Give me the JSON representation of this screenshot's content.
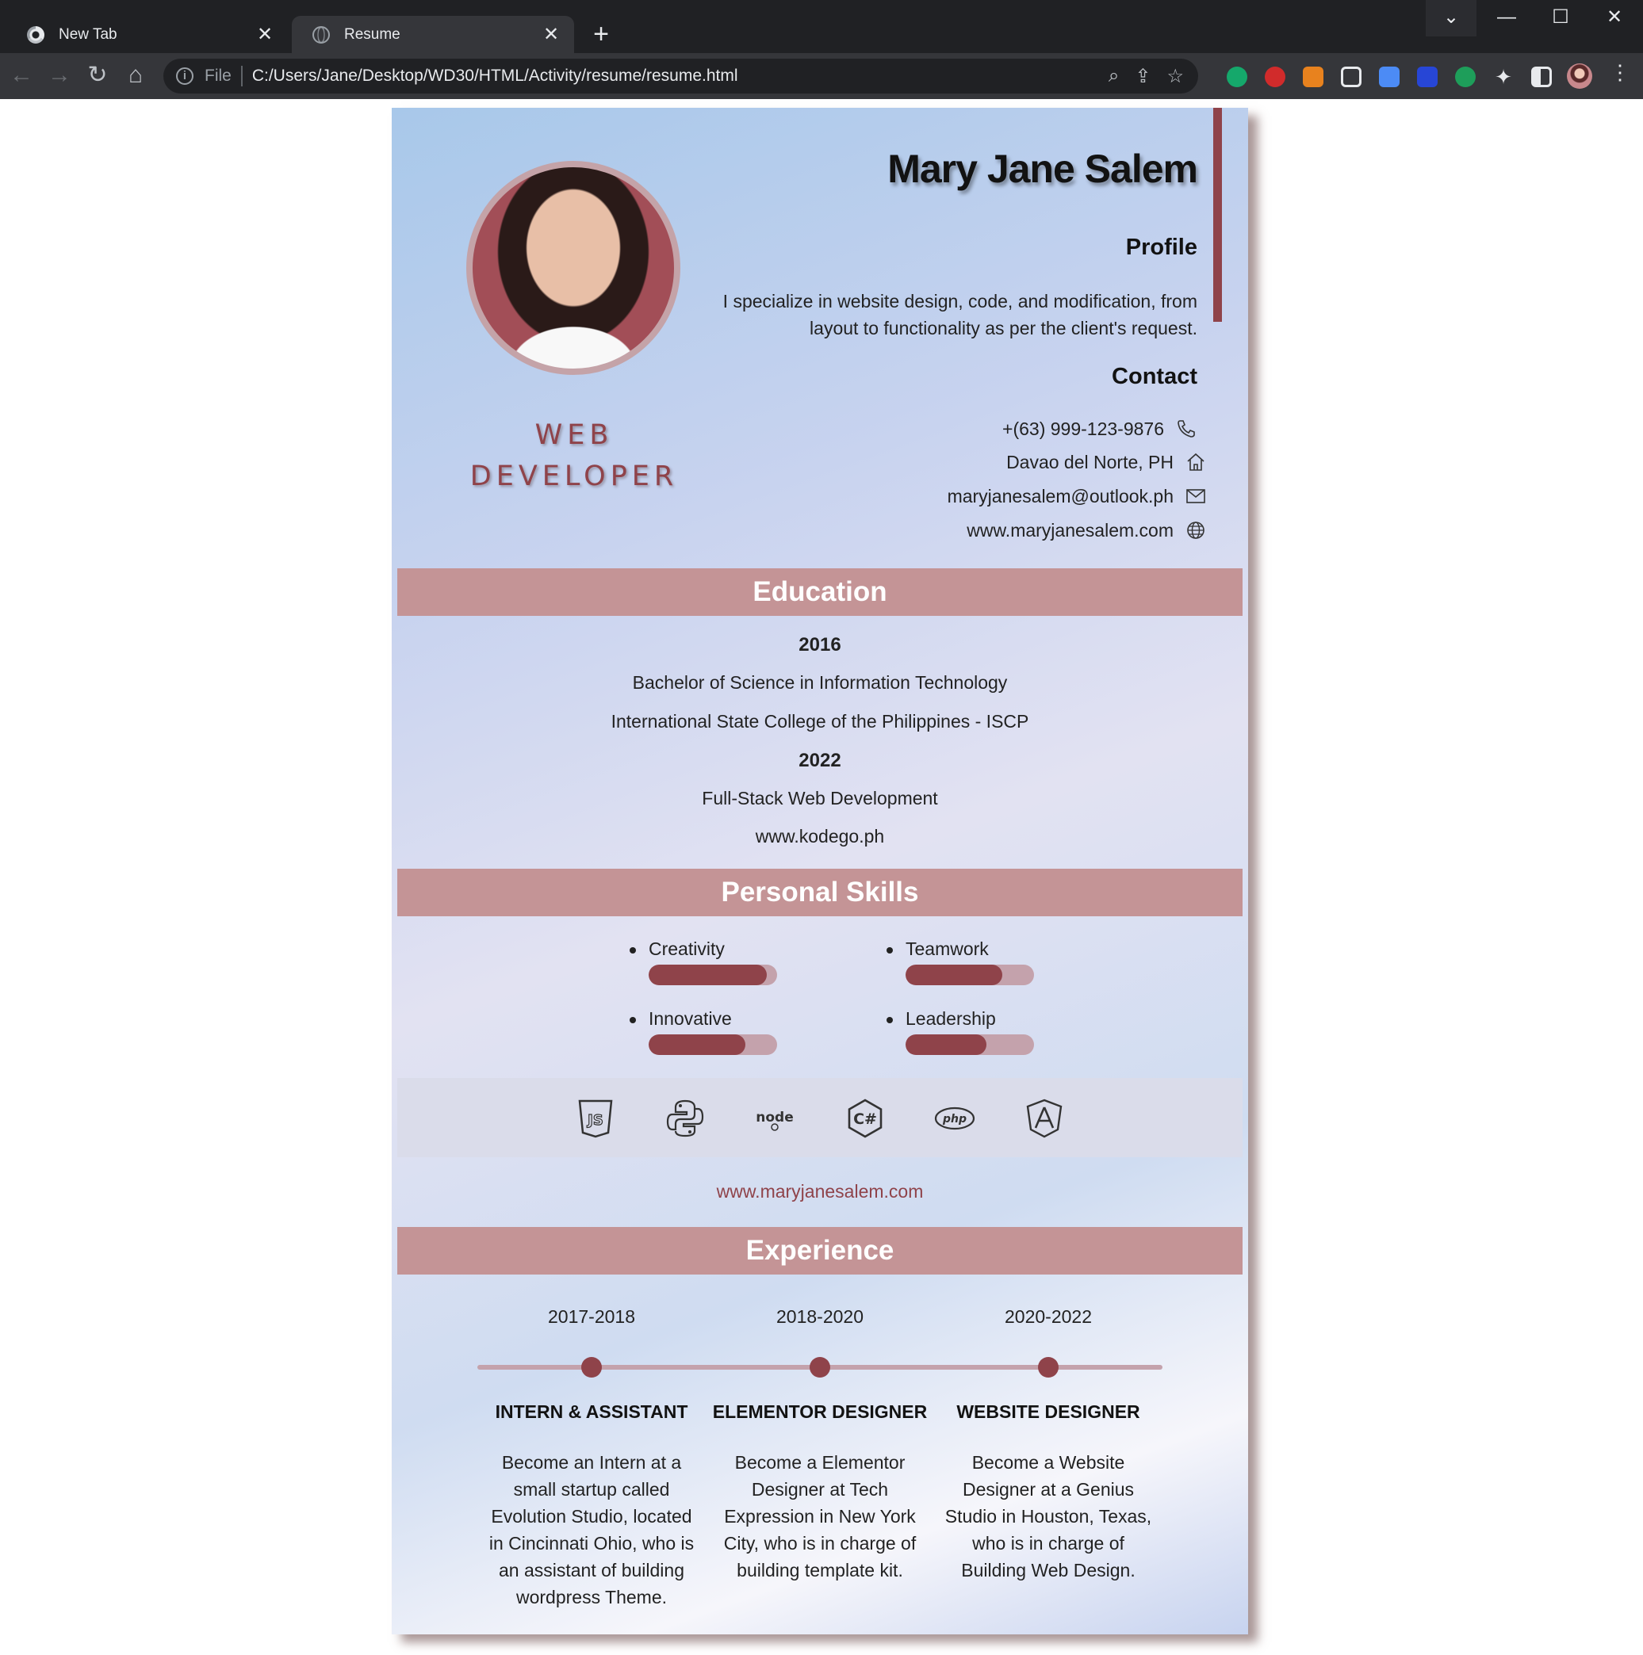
{
  "browser": {
    "tabs": [
      {
        "title": "New Tab",
        "active": false
      },
      {
        "title": "Resume",
        "active": true
      }
    ],
    "omnibox": {
      "scheme_label": "File",
      "url": "C:/Users/Jane/Desktop/WD30/HTML/Activity/resume/resume.html"
    }
  },
  "resume": {
    "name": "Mary Jane Salem",
    "role_line1": "WEB",
    "role_line2": "DEVELOPER",
    "profile_heading": "Profile",
    "profile_text": "I specialize in website design, code, and modification, from layout to functionality as per the client's request.",
    "contact_heading": "Contact",
    "contacts": [
      {
        "text": "+(63) 999-123-9876",
        "icon": "phone-icon"
      },
      {
        "text": "Davao del Norte, PH",
        "icon": "home-icon"
      },
      {
        "text": "maryjanesalem@outlook.ph",
        "icon": "mail-icon"
      },
      {
        "text": "www.maryjanesalem.com",
        "icon": "globe-icon"
      }
    ],
    "education_heading": "Education",
    "education": [
      {
        "year": "2016",
        "degree": "Bachelor of Science in Information Technology",
        "school": "International State College of the Philippines - ISCP"
      },
      {
        "year": "2022",
        "degree": "Full-Stack Web Development",
        "school": "www.kodego.ph"
      }
    ],
    "skills_heading": "Personal Skills",
    "skills": [
      {
        "label": "Creativity",
        "level": 0.92
      },
      {
        "label": "Teamwork",
        "level": 0.75
      },
      {
        "label": "Innovative",
        "level": 0.75
      },
      {
        "label": "Leadership",
        "level": 0.63
      }
    ],
    "tech_icons": [
      "javascript-icon",
      "python-icon",
      "nodejs-icon",
      "csharp-icon",
      "php-icon",
      "angular-icon"
    ],
    "website": "www.maryjanesalem.com",
    "experience_heading": "Experience",
    "experience": [
      {
        "years": "2017-2018",
        "title": "INTERN & ASSISTANT",
        "description": "Become an Intern at a small startup called Evolution Studio, located in Cincinnati Ohio, who is an assistant of building wordpress Theme."
      },
      {
        "years": "2018-2020",
        "title": "ELEMENTOR DESIGNER",
        "description": "Become a Elementor Designer at Tech Expression in New York City, who is in charge of building template kit."
      },
      {
        "years": "2020-2022",
        "title": "WEBSITE DESIGNER",
        "description": "Become a Website Designer at a Genius Studio in Houston, Texas, who is in charge of Building Web Design."
      }
    ]
  },
  "colors": {
    "accent": "#8f434a",
    "band": "#c49496",
    "track": "#c4a2ac"
  }
}
